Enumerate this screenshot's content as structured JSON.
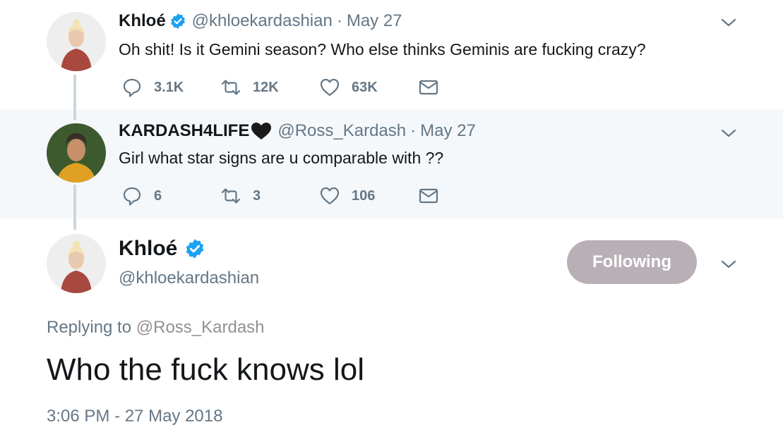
{
  "tweets": [
    {
      "name": "Khloé",
      "handle": "@khloekardashian",
      "separator": "·",
      "date": "May 27",
      "text": "Oh shit! Is it Gemini season? Who else thinks Geminis are fucking crazy?",
      "replies": "3.1K",
      "retweets": "12K",
      "likes": "63K"
    },
    {
      "name": "KARDASH4LIFE",
      "handle": "@Ross_Kardash",
      "separator": "·",
      "date": "May 27",
      "text": "Girl what star signs are u comparable with ??",
      "replies": "6",
      "retweets": "3",
      "likes": "106"
    }
  ],
  "main_tweet": {
    "name": "Khloé",
    "handle": "@khloekardashian",
    "follow_label": "Following",
    "replying_prefix": "Replying to",
    "replying_to": "@Ross_Kardash",
    "text": "Who the fuck knows lol",
    "timestamp": "3:06 PM - 27 May 2018"
  },
  "colors": {
    "verified": "#1da1f2",
    "secondary_text": "#657786",
    "thread_line": "#ccd6dd",
    "highlight_bg": "#f5f8fa",
    "following_button": "#b8b0b6"
  }
}
